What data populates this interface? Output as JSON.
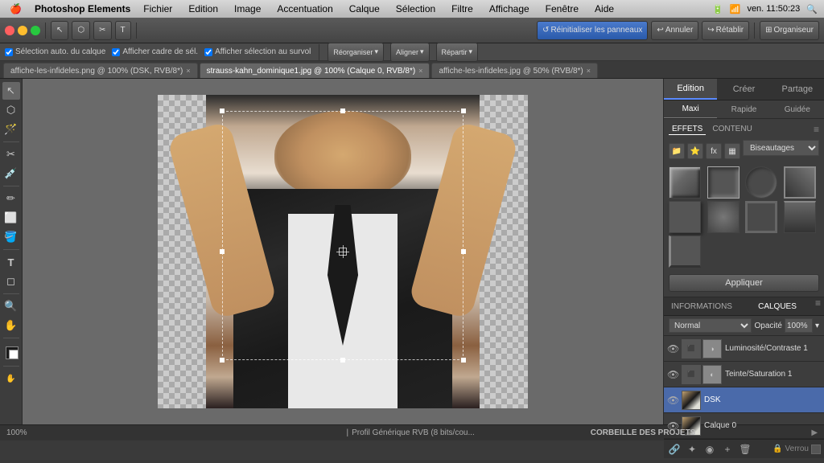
{
  "menubar": {
    "apple": "🍎",
    "app_name": "Photoshop Elements",
    "menus": [
      "Fichier",
      "Edition",
      "Image",
      "Accentuation",
      "Calque",
      "Sélection",
      "Filtre",
      "Affichage",
      "Fenêtre",
      "Aide"
    ],
    "right": {
      "time": "ven. 11:50:23"
    }
  },
  "toolbar": {
    "buttons": [
      "Réinitialiser les panneaux",
      "Annuler",
      "Rétablir",
      "Organiseur"
    ],
    "reorganiser": "Réorganiser",
    "aligner": "Aligner",
    "repartir": "Répartir"
  },
  "options_bar": {
    "items": [
      "✓ Sélection auto. du calque",
      "✓ Afficher cadre de sél.",
      "✓ Afficher sélection au survol"
    ]
  },
  "tabs": [
    {
      "label": "affiche-les-infideles.png @ 100% (DSK, RVB/8*)",
      "active": false,
      "closable": true
    },
    {
      "label": "strauss-kahn_dominique1.jpg @ 100% (Calque 0, RVB/8*)",
      "active": true,
      "closable": true
    },
    {
      "label": "affiche-les-infideles.jpg @ 50% (RVB/8*)",
      "active": false,
      "closable": true
    }
  ],
  "right_panel": {
    "tabs": [
      "Edition",
      "Créer",
      "Partage"
    ],
    "active_tab": "Edition",
    "subtabs": [
      "Maxi",
      "Rapide",
      "Guidée"
    ],
    "active_subtab": "Maxi",
    "effects_tabs": [
      "EFFETS",
      "CONTENU"
    ],
    "active_effects_tab": "EFFETS",
    "dropdown_label": "Biseautages",
    "apply_label": "Appliquer",
    "effects_grid_count": 9
  },
  "layers_panel": {
    "tabs": [
      "INFORMATIONS",
      "CALQUES"
    ],
    "active_tab": "CALQUES",
    "blend_mode": "Normal",
    "opacity_label": "Opacité",
    "opacity_value": "100%",
    "layers": [
      {
        "name": "Luminosité/Contraste 1",
        "visible": true,
        "active": false,
        "type": "adjustment"
      },
      {
        "name": "Teinte/Saturation 1",
        "visible": true,
        "active": false,
        "type": "adjustment"
      },
      {
        "name": "DSK",
        "visible": true,
        "active": true,
        "type": "image"
      },
      {
        "name": "Calque 0",
        "visible": true,
        "active": false,
        "type": "image"
      }
    ],
    "lock_label": "Verrou",
    "bottom_actions": [
      "🔗",
      "✦",
      "🗑"
    ]
  },
  "status_bar": {
    "zoom": "100%",
    "profile": "Profil Générique RVB (8 bits/cou...",
    "corbeille": "CORBEILLE DES PROJETS"
  },
  "tools": [
    "↖",
    "✂",
    "⬡",
    "🪄",
    "✏",
    "T",
    "◻",
    "🔍",
    "✋"
  ],
  "colors": {
    "active_tab_bg": "#4a6aaa",
    "panel_bg": "#3d3d3d",
    "dark_bg": "#333",
    "accent": "#5a8aff"
  }
}
